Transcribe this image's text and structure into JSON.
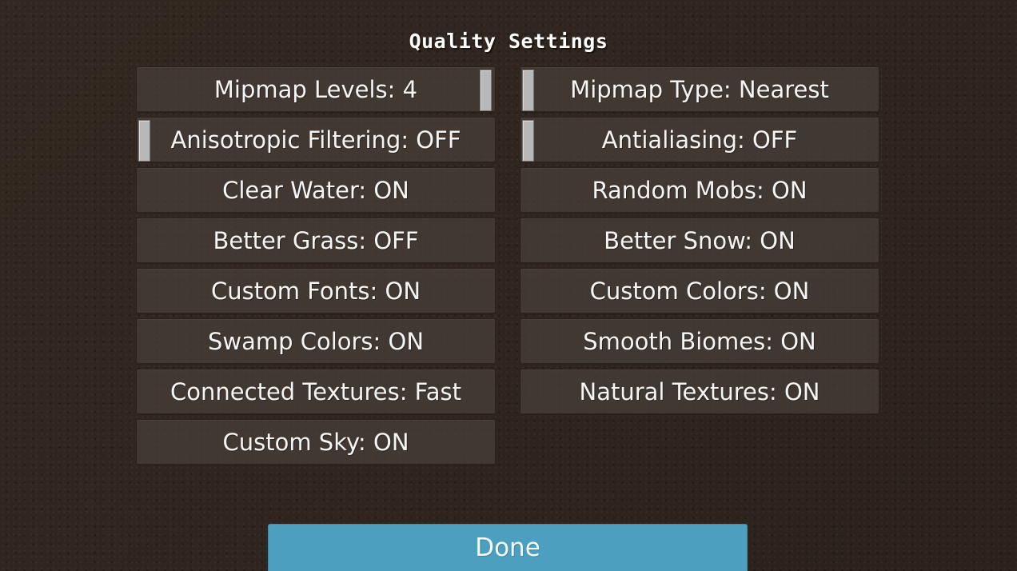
{
  "screen": {
    "title": "Quality Settings"
  },
  "options": {
    "left": [
      {
        "label": "Mipmap Levels: 4",
        "control": "slider",
        "slider_position": 1.0
      },
      {
        "label": "Anisotropic Filtering: OFF",
        "control": "slider",
        "slider_position": 0.0
      },
      {
        "label": "Clear Water: ON",
        "control": "button"
      },
      {
        "label": "Better Grass: OFF",
        "control": "button"
      },
      {
        "label": "Custom Fonts: ON",
        "control": "button"
      },
      {
        "label": "Swamp Colors: ON",
        "control": "button"
      },
      {
        "label": "Connected Textures: Fast",
        "control": "button"
      },
      {
        "label": "Custom Sky: ON",
        "control": "button"
      }
    ],
    "right": [
      {
        "label": "Mipmap Type: Nearest",
        "control": "slider",
        "slider_position": 0.0
      },
      {
        "label": "Antialiasing: OFF",
        "control": "slider",
        "slider_position": 0.0
      },
      {
        "label": "Random Mobs: ON",
        "control": "button"
      },
      {
        "label": "Better Snow: ON",
        "control": "button"
      },
      {
        "label": "Custom Colors: ON",
        "control": "button"
      },
      {
        "label": "Smooth Biomes: ON",
        "control": "button"
      },
      {
        "label": "Natural Textures: ON",
        "control": "button"
      }
    ]
  },
  "footer": {
    "done_label": "Done"
  },
  "colors": {
    "background": "#2f241d",
    "button_background": "#48403a",
    "slider_handle": "#b8b8b8",
    "done_button": "#4d9fbf",
    "text": "#f5f5f5"
  }
}
